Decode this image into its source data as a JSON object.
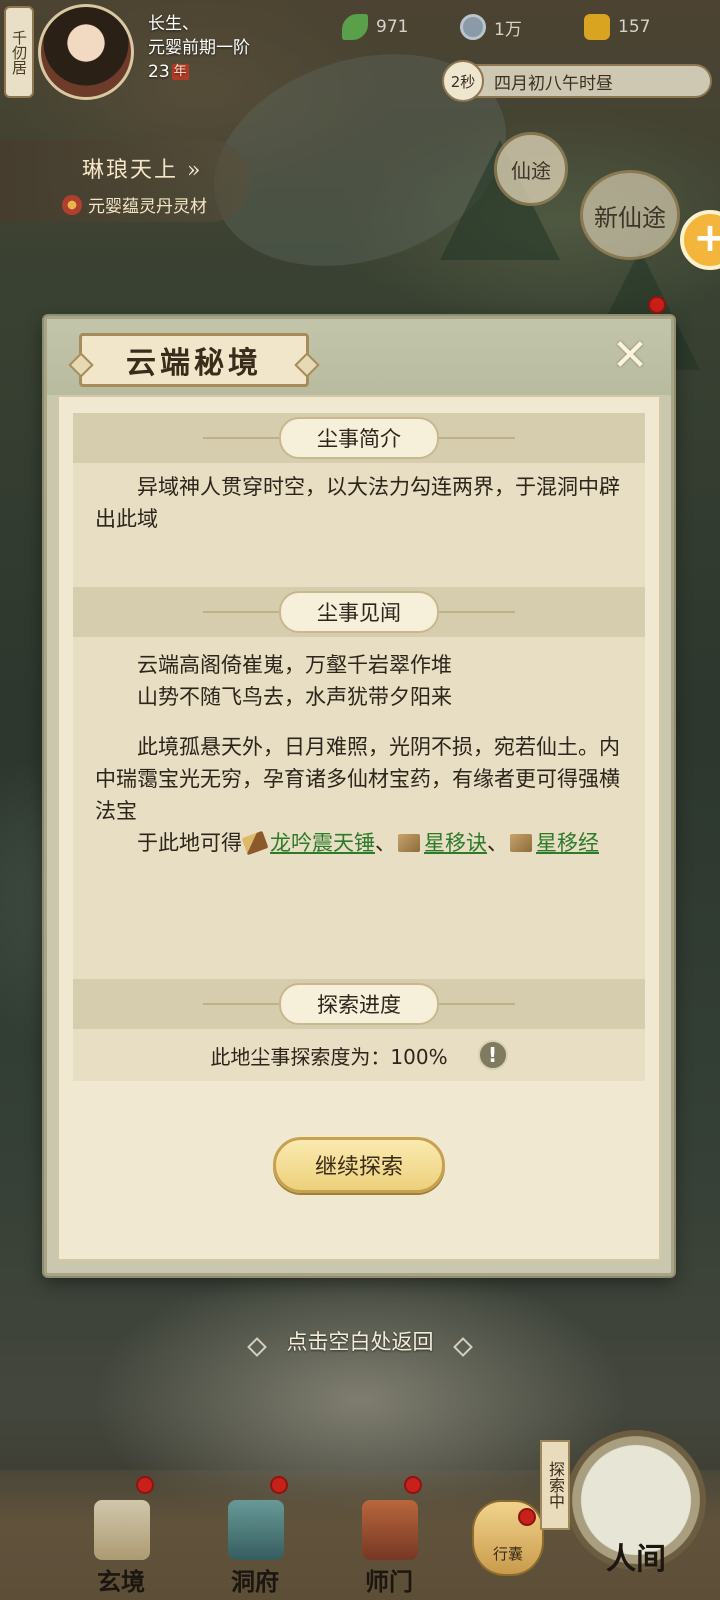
{
  "hud": {
    "residence_tab": "千仞居",
    "player": {
      "name": "长生、",
      "realm": "元婴前期一阶",
      "age": "23",
      "age_unit": "年"
    },
    "resources": [
      {
        "icon": "leaf-icon",
        "value": "971",
        "color": "#5aa04a"
      },
      {
        "icon": "coin-icon",
        "value": "1万",
        "color": "#8a9aa8"
      },
      {
        "icon": "strength-icon",
        "value": "157",
        "color": "#d9a520"
      }
    ],
    "time": {
      "seconds": "2秒",
      "label": "四月初八午时昼"
    },
    "xiantu_badge": "仙途",
    "xiantu_new": "新仙途"
  },
  "event": {
    "title": "琳琅天上",
    "chevron": "»",
    "subtitle": "元婴蕴灵丹灵材"
  },
  "modal": {
    "title": "云端秘境",
    "close_symbol": "✕",
    "sections": {
      "intro": {
        "label": "尘事简介",
        "text": "异域神人贯穿时空，以大法力勾连两界，于混洞中辟出此域"
      },
      "lore": {
        "label": "尘事见闻",
        "poem_line1": "云端高阁倚崔嵬，万壑千岩翠作堆",
        "poem_line2": "山势不随飞鸟去，水声犹带夕阳来",
        "desc": "此境孤悬天外，日月难照，光阴不损，宛若仙土。内中瑞霭宝光无穷，孕育诸多仙材宝药，有缘者更可得强横法宝",
        "obtain_prefix": "于此地可得",
        "items": [
          "龙吟震天锤",
          "星移诀",
          "星移经"
        ],
        "separator": "、"
      },
      "progress": {
        "label": "探索进度",
        "text": "此地尘事探索度为：100%",
        "info_symbol": "!"
      }
    },
    "continue_button": "继续探索"
  },
  "hint": "点击空白处返回",
  "bottom_nav": {
    "items": [
      {
        "label": "玄境"
      },
      {
        "label": "洞府"
      },
      {
        "label": "师门"
      }
    ],
    "bag": "行囊",
    "explore_tag": "探索中",
    "renjian": "人间"
  },
  "colors": {
    "link": "#2d7a2a",
    "badge_red": "#c8201a",
    "accent_gold": "#ecd07b"
  }
}
